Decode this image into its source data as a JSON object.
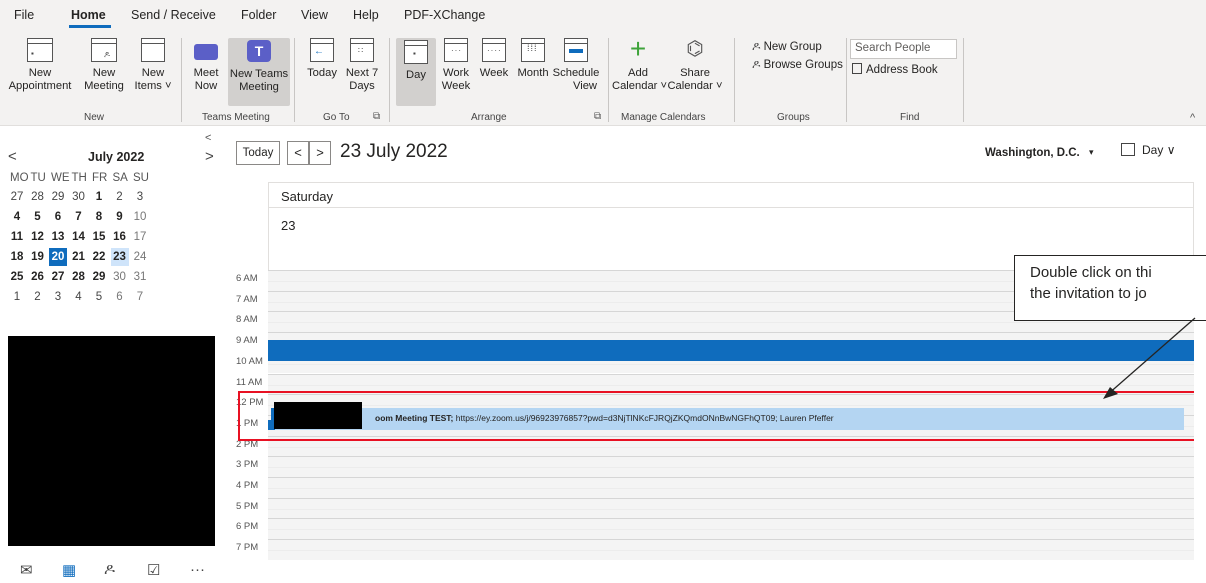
{
  "menu": {
    "items": [
      "File",
      "Home",
      "Send / Receive",
      "Folder",
      "View",
      "Help",
      "PDF-XChange"
    ]
  },
  "ribbon": {
    "new_appointment": [
      "New",
      "Appointment"
    ],
    "new_meeting": [
      "New",
      "Meeting"
    ],
    "new_items": [
      "New",
      "Items ˅"
    ],
    "meet_now": [
      "Meet",
      "Now"
    ],
    "new_teams_meeting": [
      "New Teams",
      "Meeting"
    ],
    "today": [
      "Today",
      ""
    ],
    "next7": [
      "Next 7",
      "Days"
    ],
    "day": [
      "Day",
      ""
    ],
    "work_week": [
      "Work",
      "Week"
    ],
    "week": [
      "Week",
      ""
    ],
    "month": [
      "Month",
      ""
    ],
    "schedule_view": [
      "Schedule",
      "View"
    ],
    "add_calendar": [
      "Add",
      "Calendar ˅"
    ],
    "share_calendar": [
      "Share",
      "Calendar ˅"
    ],
    "new_group": "New Group",
    "browse_groups": "Browse Groups",
    "search_people_placeholder": "Search People",
    "address_book": "Address Book",
    "groups": {
      "new": "New",
      "teams": "Teams Meeting",
      "goto": "Go To",
      "arrange": "Arrange",
      "manage": "Manage Calendars",
      "groups": "Groups",
      "find": "Find"
    }
  },
  "mini_calendar": {
    "title": "July 2022",
    "weekdays": [
      "MO",
      "TU",
      "WE",
      "TH",
      "FR",
      "SA",
      "SU"
    ],
    "weeks": [
      [
        "27",
        "28",
        "29",
        "30",
        "1",
        "2",
        "3"
      ],
      [
        "4",
        "5",
        "6",
        "7",
        "8",
        "9",
        "10"
      ],
      [
        "11",
        "12",
        "13",
        "14",
        "15",
        "16",
        "17"
      ],
      [
        "18",
        "19",
        "20",
        "21",
        "22",
        "23",
        "24"
      ],
      [
        "25",
        "26",
        "27",
        "28",
        "29",
        "30",
        "31"
      ],
      [
        "1",
        "2",
        "3",
        "4",
        "5",
        "6",
        "7"
      ]
    ]
  },
  "toolbar": {
    "today": "Today",
    "date": "23 July 2022",
    "location": "Washington, D.C.",
    "view": "Day"
  },
  "day_header": {
    "day_name": "Saturday",
    "day_number": "23"
  },
  "hours": [
    "6 AM",
    "7 AM",
    "8 AM",
    "9 AM",
    "10 AM",
    "11 AM",
    "12 PM",
    "1 PM",
    "2 PM",
    "3 PM",
    "4 PM",
    "5 PM",
    "6 PM",
    "7 PM"
  ],
  "event": {
    "title": "oom Meeting TEST;",
    "details": " https://ey.zoom.us/j/96923976857?pwd=d3NjTlNKcFJRQjZKQmdONnBwNGFhQT09; Lauren Pfeffer"
  },
  "callout": {
    "line1": "Double click on thi",
    "line2": "the invitation to jo"
  },
  "colors": {
    "accent": "#0f6cbd",
    "event_fill": "#b4d5f2",
    "highlight": "#e81123"
  }
}
